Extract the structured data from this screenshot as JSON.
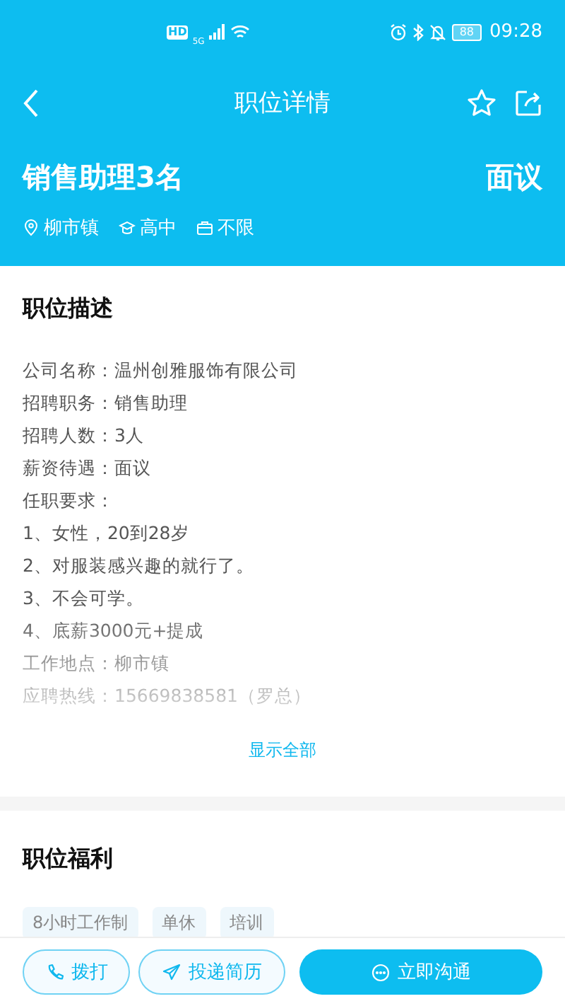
{
  "status_bar": {
    "network_badge": "HD",
    "signal_label": "5G",
    "battery": "88",
    "time": "09:28"
  },
  "nav": {
    "title": "职位详情"
  },
  "job": {
    "title": "销售助理3名",
    "salary": "面议",
    "tags": [
      {
        "kind": "location",
        "label": "柳市镇"
      },
      {
        "kind": "education",
        "label": "高中"
      },
      {
        "kind": "experience",
        "label": "不限"
      }
    ]
  },
  "description": {
    "heading": "职位描述",
    "lines": [
      "公司名称：温州创雅服饰有限公司",
      "招聘职务：销售助理",
      "招聘人数：3人",
      "薪资待遇：面议",
      "任职要求：",
      "1、女性，20到28岁",
      "2、对服装感兴趣的就行了。",
      "3、不会可学。",
      "4、底薪3000元+提成",
      "工作地点：柳市镇",
      "应聘热线：15669838581（罗总）"
    ],
    "expand_link": "显示全部"
  },
  "benefits": {
    "heading": "职位福利",
    "tags": [
      "8小时工作制",
      "单休",
      "培训"
    ]
  },
  "actions": [
    {
      "kind": "call",
      "label": "拨打"
    },
    {
      "kind": "resume",
      "label": "投递简历"
    },
    {
      "kind": "chat",
      "label": "立即沟通"
    }
  ]
}
